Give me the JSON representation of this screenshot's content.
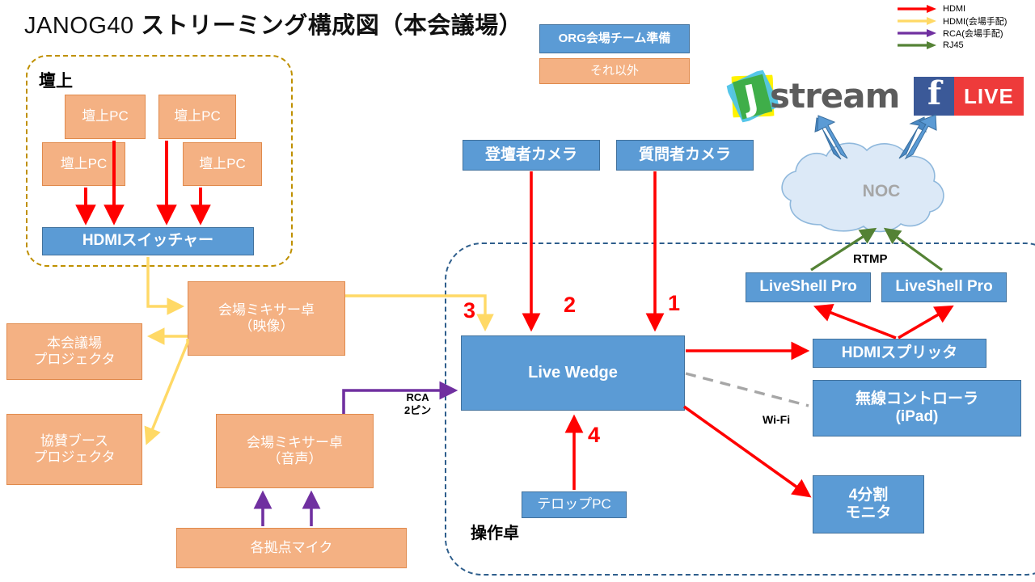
{
  "title": {
    "latin": "JANOG40 ",
    "jp": "ストリーミング構成図（本会議場）"
  },
  "legend": {
    "items": [
      {
        "label": "HDMI",
        "color": "#FF0000"
      },
      {
        "label": "HDMI(会場手配)",
        "color": "#FFD966"
      },
      {
        "label": "RCA(会場手配)",
        "color": "#7030A0"
      },
      {
        "label": "RJ45",
        "color": "#548235"
      }
    ]
  },
  "key_legend": {
    "org_label": "ORG会場チーム準備",
    "other_label": "それ以外"
  },
  "regions": {
    "stage_label": "壇上",
    "desk_label": "操作卓"
  },
  "stage": {
    "pcs": [
      {
        "label": "壇上PC"
      },
      {
        "label": "壇上PC"
      },
      {
        "label": "壇上PC"
      },
      {
        "label": "壇上PC"
      }
    ],
    "switcher": "HDMIスイッチャー"
  },
  "left": {
    "mixer_video": "会場ミキサー卓\n（映像）",
    "mixer_audio": "会場ミキサー卓\n（音声）",
    "projector_main": "本会議場\nプロジェクタ",
    "projector_booth": "協賛ブース\nプロジェクタ",
    "mics": "各拠点マイク",
    "rca_label": "RCA\n2ピン"
  },
  "center": {
    "camera_speaker": "登壇者カメラ",
    "camera_question": "質問者カメラ",
    "live_wedge": "Live Wedge",
    "telop_pc": "テロップPC",
    "numbers": [
      "3",
      "2",
      "1",
      "4"
    ]
  },
  "right": {
    "liveshell_1": "LiveShell Pro",
    "liveshell_2": "LiveShell Pro",
    "hdmi_splitter": "HDMIスプリッタ",
    "wireless_controller": "無線コントローラ\n(iPad)",
    "quad_monitor": "4分割\nモニタ",
    "noc": "NOC",
    "rtmp_label": "RTMP",
    "wifi_label": "Wi-Fi"
  },
  "logos": {
    "jstream_j": "J",
    "jstream_word": "stream",
    "facebook_f": "f",
    "facebook_live": "LIVE"
  },
  "colors": {
    "blue": "#5B9BD5",
    "orange": "#F4B183",
    "hdmi": "#FF0000",
    "hdmi_venue": "#FFD966",
    "rca": "#7030A0",
    "rj45": "#548235",
    "stage_border": "#BF9000",
    "desk_border": "#2E5E8C",
    "cloud": "#DCE9F7"
  }
}
